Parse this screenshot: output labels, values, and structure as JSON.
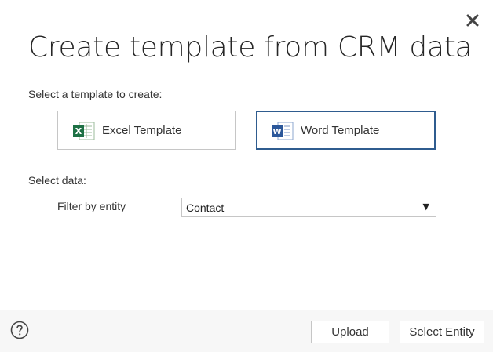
{
  "dialog": {
    "title": "Create template from CRM data"
  },
  "template_section": {
    "label": "Select a template to create:",
    "options": [
      {
        "label": "Excel Template",
        "icon": "excel-icon",
        "selected": false
      },
      {
        "label": "Word Template",
        "icon": "word-icon",
        "selected": true
      }
    ]
  },
  "data_section": {
    "label": "Select data:",
    "filter_label": "Filter by entity",
    "entity_value": "Contact",
    "dropdown_arrow": "▼"
  },
  "footer": {
    "upload_label": "Upload",
    "select_entity_label": "Select Entity"
  },
  "colors": {
    "selected_border": "#2f5c8f",
    "excel_green": "#1e7145",
    "word_blue": "#2b579a",
    "footer_bg": "#f7f7f7"
  }
}
